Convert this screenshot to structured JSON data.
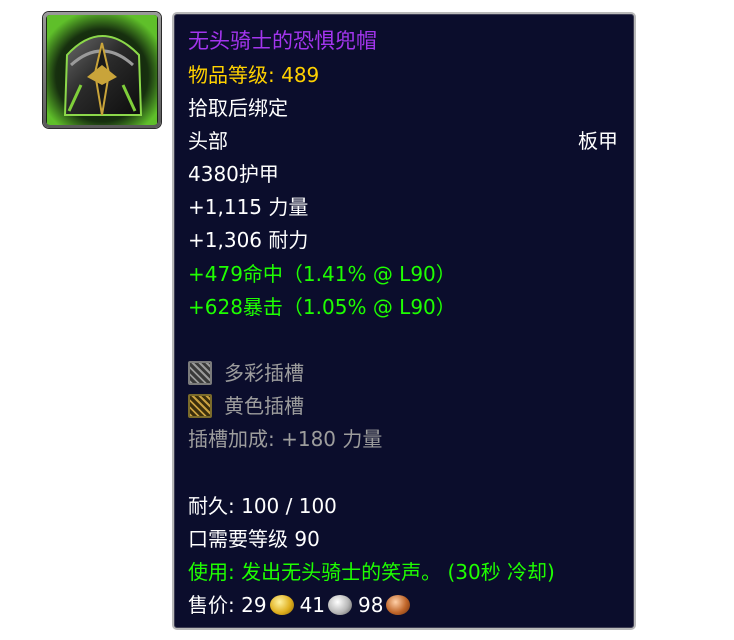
{
  "item": {
    "name": "无头骑士的恐惧兜帽",
    "item_level": "物品等级: 489",
    "binding": "拾取后绑定",
    "slot": "头部",
    "armor_type": "板甲",
    "armor": "4380护甲",
    "stats": [
      "+1,115 力量",
      "+1,306 耐力"
    ],
    "secondary_stats": [
      "+479命中（1.41% @ L90）",
      "+628暴击（1.05% @ L90）"
    ],
    "sockets": [
      {
        "label": "多彩插槽",
        "icon": "prismatic-socket-icon"
      },
      {
        "label": "黄色插槽",
        "icon": "yellow-socket-icon"
      }
    ],
    "socket_bonus": "插槽加成: +180 力量",
    "durability": "耐久: 100 / 100",
    "required_level": "口需要等级 90",
    "use_effect": "使用: 发出无头骑士的笑声。 (30秒 冷却)",
    "sell_price": {
      "label": "售价: ",
      "gold": "29",
      "silver": "41",
      "copper": "98"
    }
  },
  "colors": {
    "epic_name": "#a335ee",
    "item_level": "#ffd100",
    "green_text": "#1eff00",
    "gray_text": "#9d9d9d",
    "tooltip_background": "#0b0d2c"
  },
  "icons": {
    "item_icon": "dark-plate-helm-icon",
    "gold": "gold-coin-icon",
    "silver": "silver-coin-icon",
    "copper": "copper-coin-icon"
  }
}
